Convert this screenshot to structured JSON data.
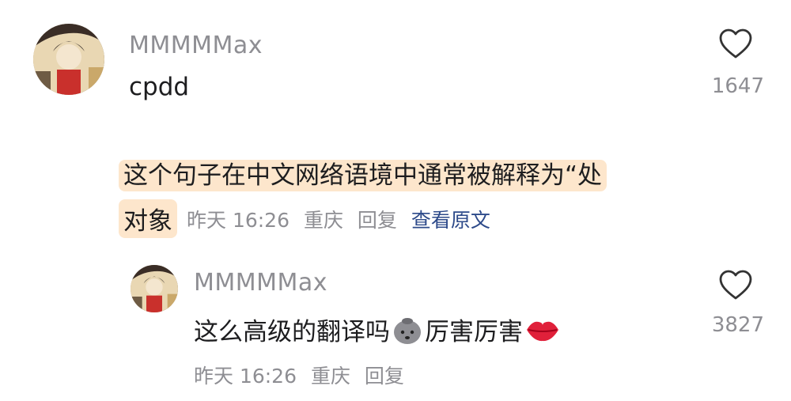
{
  "comment": {
    "username": "MMMMMax",
    "text": "cpdd",
    "likes": "1647",
    "translation_line1": "这个句子在中文网络语境中通常被解释为“处",
    "translation_line2": "对象",
    "time": "昨天 16:26",
    "location": "重庆",
    "reply_label": "回复",
    "view_original_label": "查看原文"
  },
  "reply": {
    "username": "MMMMMax",
    "text_part1": "这么高级的翻译吗",
    "text_part2": "厉害厉害",
    "likes": "3827",
    "time": "昨天 16:26",
    "location": "重庆",
    "reply_label": "回复"
  },
  "icons": {
    "like": "heart-outline-icon",
    "emoji1": "gray-blob-emoji-icon",
    "emoji2": "lips-emoji-icon"
  }
}
